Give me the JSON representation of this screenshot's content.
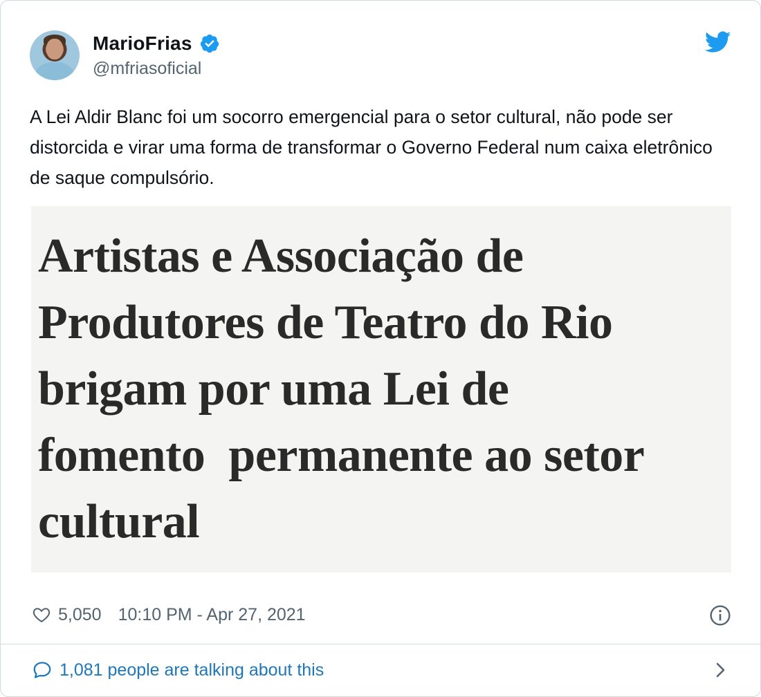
{
  "author": {
    "display_name": "MarioFrias",
    "handle": "@mfriasoficial"
  },
  "tweet": {
    "text": "A Lei Aldir Blanc foi um socorro emergencial para o setor cultural, não pode ser distorcida e virar uma forma de transformar o Governo Federal num caixa eletrônico de saque compulsório.",
    "media_headline_lines": [
      "Artistas e Associação de",
      "Produtores de Teatro do Rio",
      "brigam por uma Lei de",
      "fomento  permanente ao setor",
      "cultural"
    ]
  },
  "stats": {
    "likes": "5,050",
    "timestamp": "10:10 PM - Apr 27, 2021"
  },
  "footer": {
    "talking_text": "1,081 people are talking about this"
  },
  "icons": {
    "verified": "verified-badge-icon",
    "bird": "twitter-bird-icon",
    "heart": "heart-icon",
    "info": "info-icon",
    "bubble": "speech-bubble-icon",
    "chevron": "chevron-right-icon"
  },
  "colors": {
    "twitter_blue": "#1d9bf0",
    "link_blue": "#1d77b8",
    "text": "#0f1419",
    "muted": "#536471"
  }
}
